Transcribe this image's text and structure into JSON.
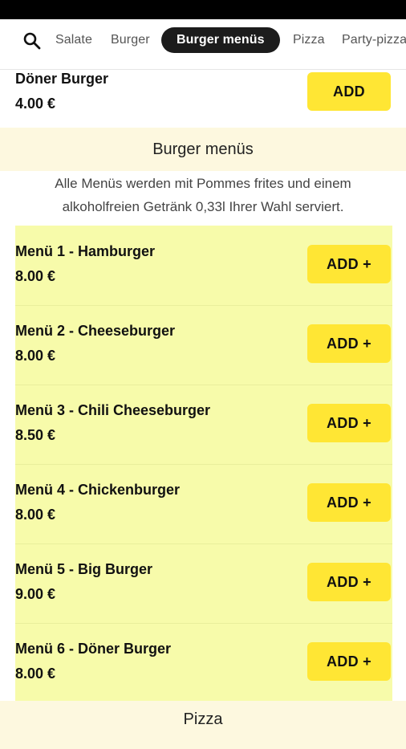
{
  "nav": {
    "search_icon": "search-icon",
    "tabs": [
      {
        "label": "Salate"
      },
      {
        "label": "Burger"
      },
      {
        "label": "Burger menüs"
      },
      {
        "label": "Pizza"
      },
      {
        "label": "Party-pizza"
      }
    ]
  },
  "previous_item": {
    "name": "Döner Burger",
    "price": "4.00 €",
    "button": "ADD"
  },
  "category": {
    "title": "Burger menüs",
    "description_line1": "Alle Menüs werden mit Pommes frites und einem",
    "description_line2": "alkoholfreien Getränk 0,33l Ihrer Wahl serviert."
  },
  "menus": [
    {
      "name": "Menü 1 - Hamburger",
      "price": "8.00 €",
      "button": "ADD +"
    },
    {
      "name": "Menü 2 - Cheeseburger",
      "price": "8.00 €",
      "button": "ADD +"
    },
    {
      "name": "Menü 3 - Chili Cheeseburger",
      "price": "8.50 €",
      "button": "ADD +"
    },
    {
      "name": "Menü 4 - Chickenburger",
      "price": "8.00 €",
      "button": "ADD +"
    },
    {
      "name": "Menü 5 - Big Burger",
      "price": "9.00 €",
      "button": "ADD +"
    },
    {
      "name": "Menü 6 - Döner Burger",
      "price": "8.00 €",
      "button": "ADD +"
    }
  ],
  "next_category": {
    "title": "Pizza"
  },
  "colors": {
    "accent_button": "#ffe634",
    "highlight_area": "#f7fbaa",
    "category_bg": "#fdf8df",
    "active_tab": "#1c1c1c"
  }
}
